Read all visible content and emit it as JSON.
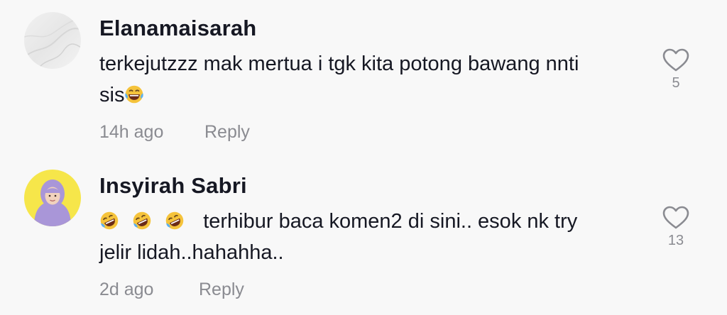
{
  "comments": [
    {
      "author": "Elanamaisarah",
      "text_line1": "terkejutzzz mak mertua i tgk kita potong bawang nnti",
      "text_line2": "sis",
      "emoji": "face-with-tears-of-joy",
      "time": "14h ago",
      "reply_label": "Reply",
      "likes": "5"
    },
    {
      "author": "Insyirah Sabri",
      "text_line1": "terhibur baca komen2 di sini.. esok nk try",
      "text_line2": "jelir lidah..hahahha..",
      "emoji": "rolling-on-the-floor-laughing",
      "time": "2d ago",
      "reply_label": "Reply",
      "likes": "13"
    }
  ],
  "colors": {
    "background": "#f8f8f8",
    "primary_text": "#161823",
    "secondary_text": "#8a8b91",
    "avatar2_bg": "#f6e64a",
    "hijab": "#a996d8"
  }
}
